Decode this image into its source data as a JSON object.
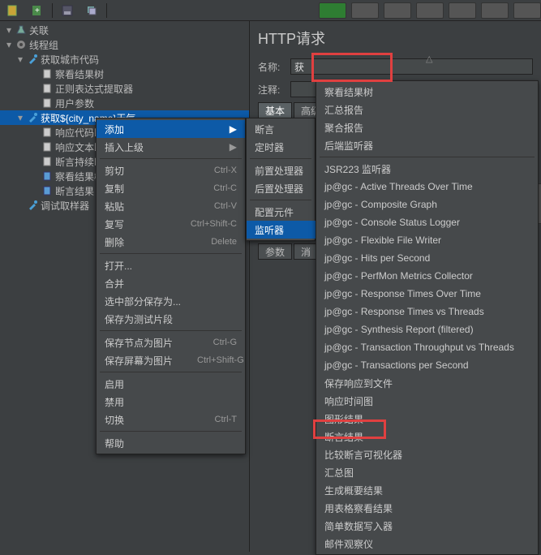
{
  "toolbar": {
    "icons": [
      "file-yellow",
      "file-green",
      "disk",
      "copy",
      "",
      ""
    ]
  },
  "tree": {
    "root": "关联",
    "items": [
      {
        "label": "线程组",
        "icon": "gear",
        "indent": 1,
        "twisty": "▾"
      },
      {
        "label": "获取城市代码",
        "icon": "pipette",
        "indent": 2,
        "twisty": "▾"
      },
      {
        "label": "察看结果树",
        "icon": "doc",
        "indent": 3
      },
      {
        "label": "正则表达式提取器",
        "icon": "doc",
        "indent": 3
      },
      {
        "label": "用户参数",
        "icon": "doc",
        "indent": 3
      },
      {
        "label": "获取${city_name}天气",
        "icon": "pipette",
        "indent": 2,
        "selected": true,
        "twisty": "▾"
      },
      {
        "label": "响应代码断言",
        "icon": "doc",
        "indent": 3
      },
      {
        "label": "响应文本断言",
        "icon": "doc",
        "indent": 3
      },
      {
        "label": "断言持续时间",
        "icon": "doc",
        "indent": 3
      },
      {
        "label": "察看结果树",
        "icon": "doc-blue",
        "indent": 3
      },
      {
        "label": "断言结果",
        "icon": "doc-blue",
        "indent": 3
      },
      {
        "label": "调试取样器",
        "icon": "pipette",
        "indent": 2
      }
    ]
  },
  "right": {
    "title": "HTTP请求",
    "name_label": "名称:",
    "name_value": "获",
    "comment_label": "注释:",
    "tabs": {
      "basic": "基本",
      "advanced": "高级"
    },
    "sub": {
      "params": "参数",
      "body": "消"
    }
  },
  "menu1": [
    {
      "label": "添加",
      "arrow": true,
      "sel": true
    },
    {
      "label": "插入上级",
      "arrow": true
    },
    {
      "sep": true
    },
    {
      "label": "剪切",
      "shortcut": "Ctrl-X"
    },
    {
      "label": "复制",
      "shortcut": "Ctrl-C"
    },
    {
      "label": "粘贴",
      "shortcut": "Ctrl-V"
    },
    {
      "label": "复写",
      "shortcut": "Ctrl+Shift-C"
    },
    {
      "label": "删除",
      "shortcut": "Delete"
    },
    {
      "sep": true
    },
    {
      "label": "打开..."
    },
    {
      "label": "合并"
    },
    {
      "label": "选中部分保存为..."
    },
    {
      "label": "保存为测试片段"
    },
    {
      "sep": true
    },
    {
      "label": "保存节点为图片",
      "shortcut": "Ctrl-G"
    },
    {
      "label": "保存屏幕为图片",
      "shortcut": "Ctrl+Shift-G"
    },
    {
      "sep": true
    },
    {
      "label": "启用"
    },
    {
      "label": "禁用"
    },
    {
      "label": "切换",
      "shortcut": "Ctrl-T"
    },
    {
      "sep": true
    },
    {
      "label": "帮助"
    }
  ],
  "menu2": [
    {
      "label": "断言",
      "arrow": true
    },
    {
      "label": "定时器",
      "arrow": true
    },
    {
      "sep": true
    },
    {
      "label": "前置处理器",
      "arrow": true
    },
    {
      "label": "后置处理器",
      "arrow": true
    },
    {
      "sep": true
    },
    {
      "label": "配置元件",
      "arrow": true
    },
    {
      "label": "监听器",
      "arrow": true,
      "sel": true
    }
  ],
  "menu3": [
    {
      "label": "察看结果树"
    },
    {
      "label": "汇总报告"
    },
    {
      "label": "聚合报告"
    },
    {
      "label": "后端监听器"
    },
    {
      "sep": true
    },
    {
      "label": "JSR223 监听器"
    },
    {
      "label": "jp@gc - Active Threads Over Time"
    },
    {
      "label": "jp@gc - Composite Graph"
    },
    {
      "label": "jp@gc - Console Status Logger"
    },
    {
      "label": "jp@gc - Flexible File Writer"
    },
    {
      "label": "jp@gc - Hits per Second"
    },
    {
      "label": "jp@gc - PerfMon Metrics Collector"
    },
    {
      "label": "jp@gc - Response Times Over Time"
    },
    {
      "label": "jp@gc - Response Times vs Threads"
    },
    {
      "label": "jp@gc - Synthesis Report (filtered)"
    },
    {
      "label": "jp@gc - Transaction Throughput vs Threads"
    },
    {
      "label": "jp@gc - Transactions per Second"
    },
    {
      "label": "保存响应到文件"
    },
    {
      "label": "响应时间图"
    },
    {
      "label": "图形结果"
    },
    {
      "label": "断言结果"
    },
    {
      "label": "比较断言可视化器"
    },
    {
      "label": "汇总图"
    },
    {
      "label": "生成概要结果"
    },
    {
      "label": "用表格察看结果"
    },
    {
      "label": "简单数据写入器"
    },
    {
      "label": "邮件观察仪"
    }
  ]
}
